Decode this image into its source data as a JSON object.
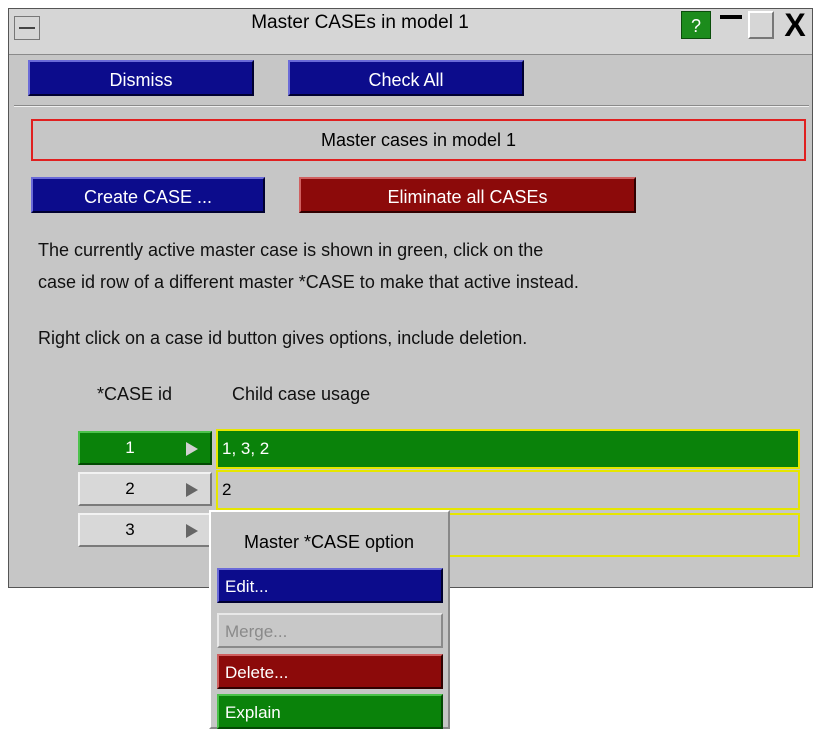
{
  "window": {
    "title": "Master CASEs in model 1",
    "help_label": "?",
    "close_glyph": "X"
  },
  "toolbar": {
    "dismiss_label": "Dismiss",
    "check_all_label": "Check All"
  },
  "header_box": {
    "text": "Master cases in model 1"
  },
  "actions": {
    "create_label": "Create CASE ...",
    "eliminate_label": "Eliminate all CASEs"
  },
  "description": {
    "line1": "The currently active master case is shown in green, click on the",
    "line2": "case id row of a different master *CASE to make that active instead.",
    "line3": "Right click on a case id button gives options, include deletion."
  },
  "table": {
    "col_case_id": "*CASE id",
    "col_child_usage": "Child case usage",
    "rows": [
      {
        "id": "1",
        "usage": "1, 3, 2",
        "active": true
      },
      {
        "id": "2",
        "usage": "2",
        "active": false
      },
      {
        "id": "3",
        "usage": "",
        "active": false
      }
    ]
  },
  "context_menu": {
    "title": "Master *CASE option",
    "items": [
      {
        "label": "Edit...",
        "enabled": true,
        "color": "blue"
      },
      {
        "label": "Merge...",
        "enabled": false,
        "color": "grey"
      },
      {
        "label": "Delete...",
        "enabled": true,
        "color": "red"
      },
      {
        "label": "Explain",
        "enabled": true,
        "color": "green"
      }
    ]
  },
  "colors": {
    "panel": "#c6c6c6",
    "blue_button": "#0c0c8c",
    "red_button": "#8c0a0a",
    "active_green": "#0a820a",
    "highlight_yellow": "#e6e600",
    "info_border": "#e02020"
  }
}
